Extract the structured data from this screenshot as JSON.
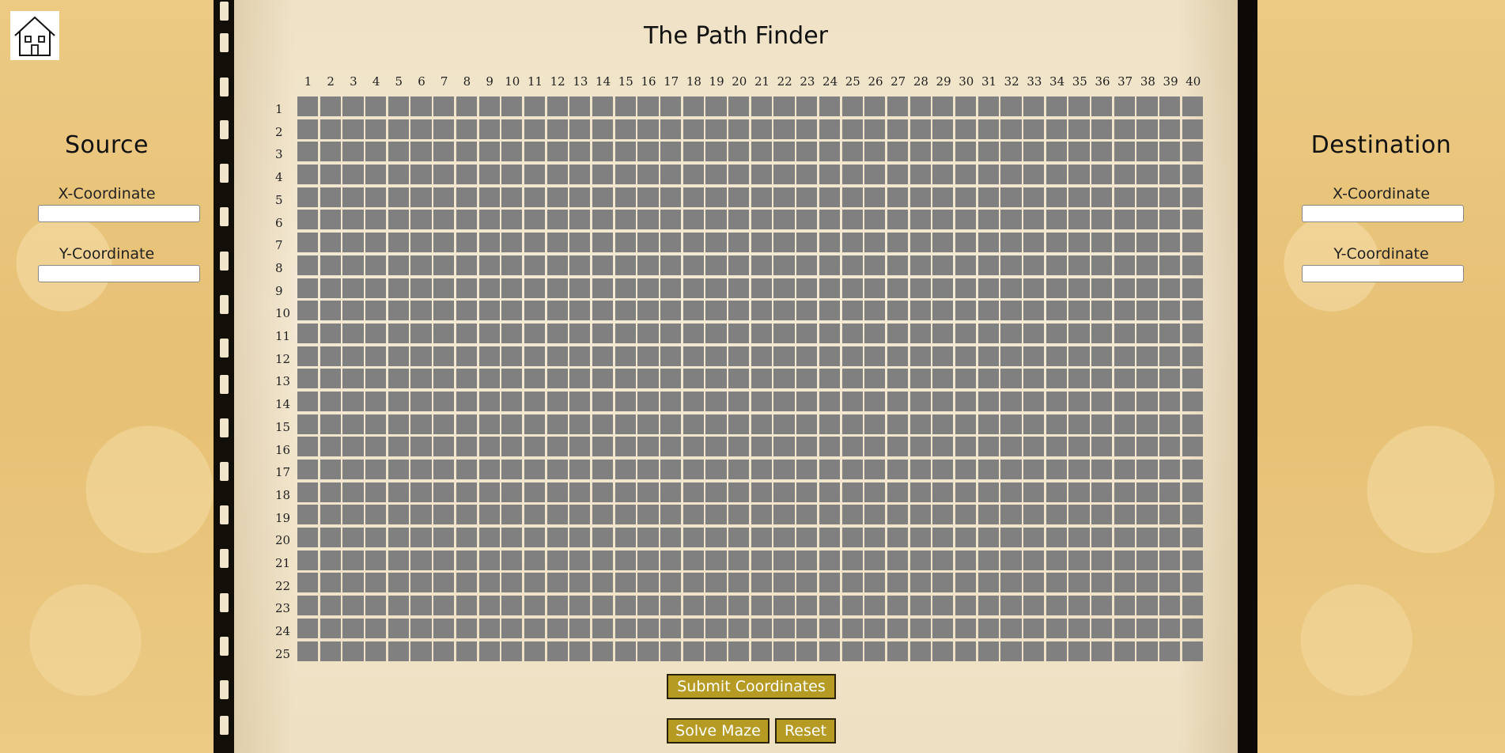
{
  "page": {
    "title": "The Path Finder"
  },
  "home": {
    "icon": "home-icon"
  },
  "source": {
    "title": "Source",
    "x_label": "X-Coordinate",
    "y_label": "Y-Coordinate",
    "x_value": "",
    "y_value": ""
  },
  "destination": {
    "title": "Destination",
    "x_label": "X-Coordinate",
    "y_label": "Y-Coordinate",
    "x_value": "",
    "y_value": ""
  },
  "grid": {
    "columns": [
      "1",
      "2",
      "3",
      "4",
      "5",
      "6",
      "7",
      "8",
      "9",
      "10",
      "11",
      "12",
      "13",
      "14",
      "15",
      "16",
      "17",
      "18",
      "19",
      "20",
      "21",
      "22",
      "23",
      "24",
      "25",
      "26",
      "27",
      "28",
      "29",
      "30",
      "31",
      "32",
      "33",
      "34",
      "35",
      "36",
      "37",
      "38",
      "39",
      "40"
    ],
    "rows": [
      "1",
      "2",
      "3",
      "4",
      "5",
      "6",
      "7",
      "8",
      "9",
      "10",
      "11",
      "12",
      "13",
      "14",
      "15",
      "16",
      "17",
      "18",
      "19",
      "20",
      "21",
      "22",
      "23",
      "24",
      "25"
    ],
    "cell_color": "#808080"
  },
  "buttons": {
    "submit": "Submit Coordinates",
    "solve": "Solve Maze",
    "reset": "Reset"
  },
  "colors": {
    "button_bg": "#b59a24",
    "side_bg": "#e9c77f",
    "paper_bg": "#f1e6cc"
  }
}
